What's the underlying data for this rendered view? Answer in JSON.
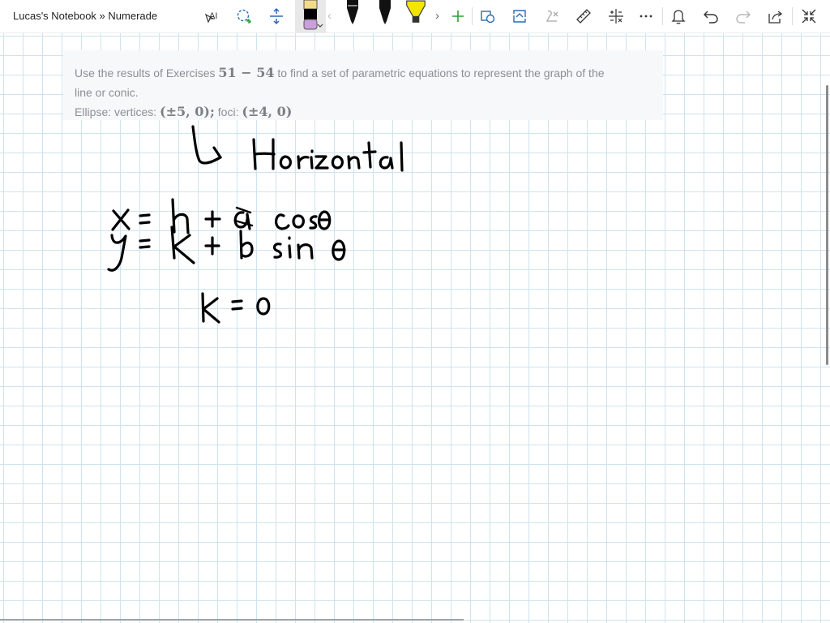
{
  "header": {
    "breadcrumb": "Lucas's Notebook » Numerade"
  },
  "toolbar": {
    "tools": [
      {
        "name": "text-insert-icon"
      },
      {
        "name": "lasso-select-icon"
      },
      {
        "name": "space-insert-icon"
      },
      {
        "name": "pen-yellow-black-icon",
        "colors": [
          "#f5d98b",
          "#000000",
          "#c9a0dc"
        ]
      },
      {
        "name": "pen-black-icon",
        "color": "#000000"
      },
      {
        "name": "pen-black-2-icon",
        "color": "#000000"
      },
      {
        "name": "highlighter-yellow-icon",
        "color": "#f2e600"
      },
      {
        "name": "add-pen-icon",
        "color": "#2e9e3a"
      },
      {
        "name": "shape-recognize-icon"
      },
      {
        "name": "ink-to-shape-icon"
      },
      {
        "name": "ink-to-math-icon"
      },
      {
        "name": "ruler-icon"
      },
      {
        "name": "math-icon"
      },
      {
        "name": "more-options-icon"
      },
      {
        "name": "bell-icon"
      },
      {
        "name": "undo-icon"
      },
      {
        "name": "redo-icon"
      },
      {
        "name": "share-icon"
      },
      {
        "name": "fullscreen-icon"
      }
    ],
    "accent": "#2b6cb0"
  },
  "question": {
    "line1_prefix": "Use the results of Exercises ",
    "line1_math": "51 − 54",
    "line1_suffix": " to find a set of parametric equations to represent the graph of the",
    "line2": "line or conic.",
    "line3_prefix": "Ellipse: vertices: ",
    "line3_math1": "(±5, 0);",
    "line3_mid": " foci: ",
    "line3_math2": "(±4, 0)"
  },
  "handwriting": {
    "text": [
      "Horizontal",
      "x = h + a cos θ",
      "y = k + b sin θ",
      "k = 0"
    ],
    "ink_color": "#000000"
  },
  "colors": {
    "grid": "#cfe3ee",
    "question_bg": "#f7f8f9",
    "question_text": "#8a8f96"
  }
}
